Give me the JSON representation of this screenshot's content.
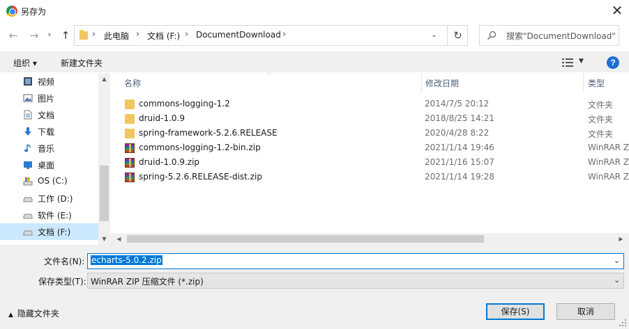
{
  "window": {
    "title": "另存为"
  },
  "address": {
    "crumbs": [
      "此电脑",
      "文档 (F:)",
      "DocumentDownload"
    ]
  },
  "search": {
    "placeholder": "搜索\"DocumentDownload\""
  },
  "toolbar": {
    "organize": "组织 ▾",
    "new_folder": "新建文件夹"
  },
  "navpane": {
    "items": [
      {
        "label": "视频",
        "icon": "video-icon"
      },
      {
        "label": "图片",
        "icon": "pictures-icon"
      },
      {
        "label": "文档",
        "icon": "documents-icon"
      },
      {
        "label": "下载",
        "icon": "download-icon"
      },
      {
        "label": "音乐",
        "icon": "music-icon"
      },
      {
        "label": "桌面",
        "icon": "desktop-icon"
      },
      {
        "label": "OS (C:)",
        "icon": "os-drive-icon"
      },
      {
        "label": "工作 (D:)",
        "icon": "drive-icon"
      },
      {
        "label": "软件 (E:)",
        "icon": "drive-icon"
      },
      {
        "label": "文档 (F:)",
        "icon": "drive-icon",
        "selected": true
      }
    ]
  },
  "columns": {
    "name": "名称",
    "date": "修改日期",
    "type": "类型"
  },
  "files": [
    {
      "name": "commons-logging-1.2",
      "date": "2014/7/5 20:12",
      "type": "文件夹",
      "kind": "folder"
    },
    {
      "name": "druid-1.0.9",
      "date": "2018/8/25 14:21",
      "type": "文件夹",
      "kind": "folder"
    },
    {
      "name": "spring-framework-5.2.6.RELEASE",
      "date": "2020/4/28 8:22",
      "type": "文件夹",
      "kind": "folder"
    },
    {
      "name": "commons-logging-1.2-bin.zip",
      "date": "2021/1/14 19:46",
      "type": "WinRAR Z",
      "kind": "zip"
    },
    {
      "name": "druid-1.0.9.zip",
      "date": "2021/1/16 15:07",
      "type": "WinRAR Z",
      "kind": "zip"
    },
    {
      "name": "spring-5.2.6.RELEASE-dist.zip",
      "date": "2021/1/14 19:28",
      "type": "WinRAR Z",
      "kind": "zip"
    }
  ],
  "form": {
    "filename_label": "文件名(N):",
    "filename_value": "echarts-5.0.2.zip",
    "filetype_label": "保存类型(T):",
    "filetype_value": "WinRAR ZIP 压缩文件 (*.zip)"
  },
  "footer": {
    "hide_folders": "隐藏文件夹",
    "save": "保存(S)",
    "cancel": "取消"
  },
  "colors": {
    "accent": "#0078d7",
    "selection": "#cce8ff",
    "folder": "#f0c75e"
  }
}
